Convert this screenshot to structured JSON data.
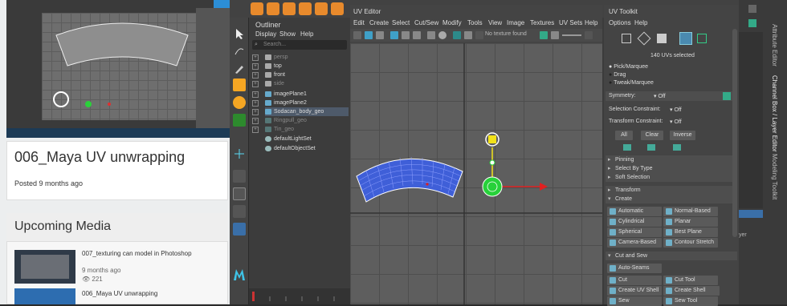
{
  "web": {
    "post_title": "006_Maya UV unwrapping",
    "post_meta": "Posted 9 months ago",
    "upcoming_title": "Upcoming Media",
    "media": [
      {
        "title": "007_texturing can model in Photoshop",
        "time": "9 months ago",
        "views": "221"
      },
      {
        "title": "006_Maya UV unwrapping"
      }
    ],
    "view_icon": "👁"
  },
  "outliner": {
    "title": "Outliner",
    "menu": [
      "Display",
      "Show",
      "Help"
    ],
    "search_placeholder": "Search...",
    "items": [
      {
        "label": "persp",
        "dim": true
      },
      {
        "label": "top",
        "dim": false
      },
      {
        "label": "front",
        "dim": false
      },
      {
        "label": "side",
        "dim": true
      },
      {
        "label": "imagePlane1",
        "dim": false
      },
      {
        "label": "imagePlane2",
        "dim": false
      },
      {
        "label": "Sodacan_body_geo",
        "dim": false,
        "selected": true
      },
      {
        "label": "Ringpull_geo",
        "dim": true
      },
      {
        "label": "Tin_geo",
        "dim": true
      },
      {
        "label": "defaultLightSet",
        "dim": false
      },
      {
        "label": "defaultObjectSet",
        "dim": false
      }
    ]
  },
  "uv_editor": {
    "title": "UV Editor",
    "menu": [
      "Edit",
      "Create",
      "Select",
      "Cut/Sew",
      "Modify",
      "Tools",
      "View",
      "Image",
      "Textures",
      "UV Sets",
      "Help"
    ],
    "no_texture": "No texture found"
  },
  "uv_toolkit": {
    "title": "UV Toolkit",
    "menu": [
      "Options",
      "Help"
    ],
    "selected_count": "140 UVs selected",
    "modes": [
      "Pick/Marquee",
      "Drag",
      "Tweak/Marquee"
    ],
    "symmetry_label": "Symmetry:",
    "symmetry_value": "Off",
    "selection_constraint_label": "Selection Constraint:",
    "selection_constraint_value": "Off",
    "transform_constraint_label": "Transform Constraint:",
    "transform_constraint_value": "Off",
    "buttons": [
      "All",
      "Clear",
      "Inverse"
    ],
    "sections_collapsed": [
      "Pinning",
      "Select By Type",
      "Soft Selection"
    ],
    "transform_section": "Transform",
    "create_section": "Create",
    "create_buttons": [
      "Automatic",
      "Normal-Based",
      "Cylindrical",
      "Planar",
      "Spherical",
      "Best Plane",
      "Camera-Based",
      "Contour Stretch"
    ],
    "cut_sew_section": "Cut and Sew",
    "auto_seams": "Auto-Seams",
    "cut_buttons": [
      "Cut",
      "Cut Tool",
      "Create UV Shell",
      "Create Shell (Grid)",
      "Sew",
      "Sew Tool"
    ]
  },
  "right_panel": {
    "tabs": [
      "Attribute Editor",
      "Channel Box / Layer Editor",
      "Modeling Toolkit"
    ],
    "layer_label": "yer"
  },
  "colors": {
    "accent_orange": "#e88a2c",
    "uv_shell_blue": "#3f5fd8",
    "manip_green": "#27d13a",
    "manip_red": "#e02020",
    "manip_yellow": "#f2e219"
  }
}
